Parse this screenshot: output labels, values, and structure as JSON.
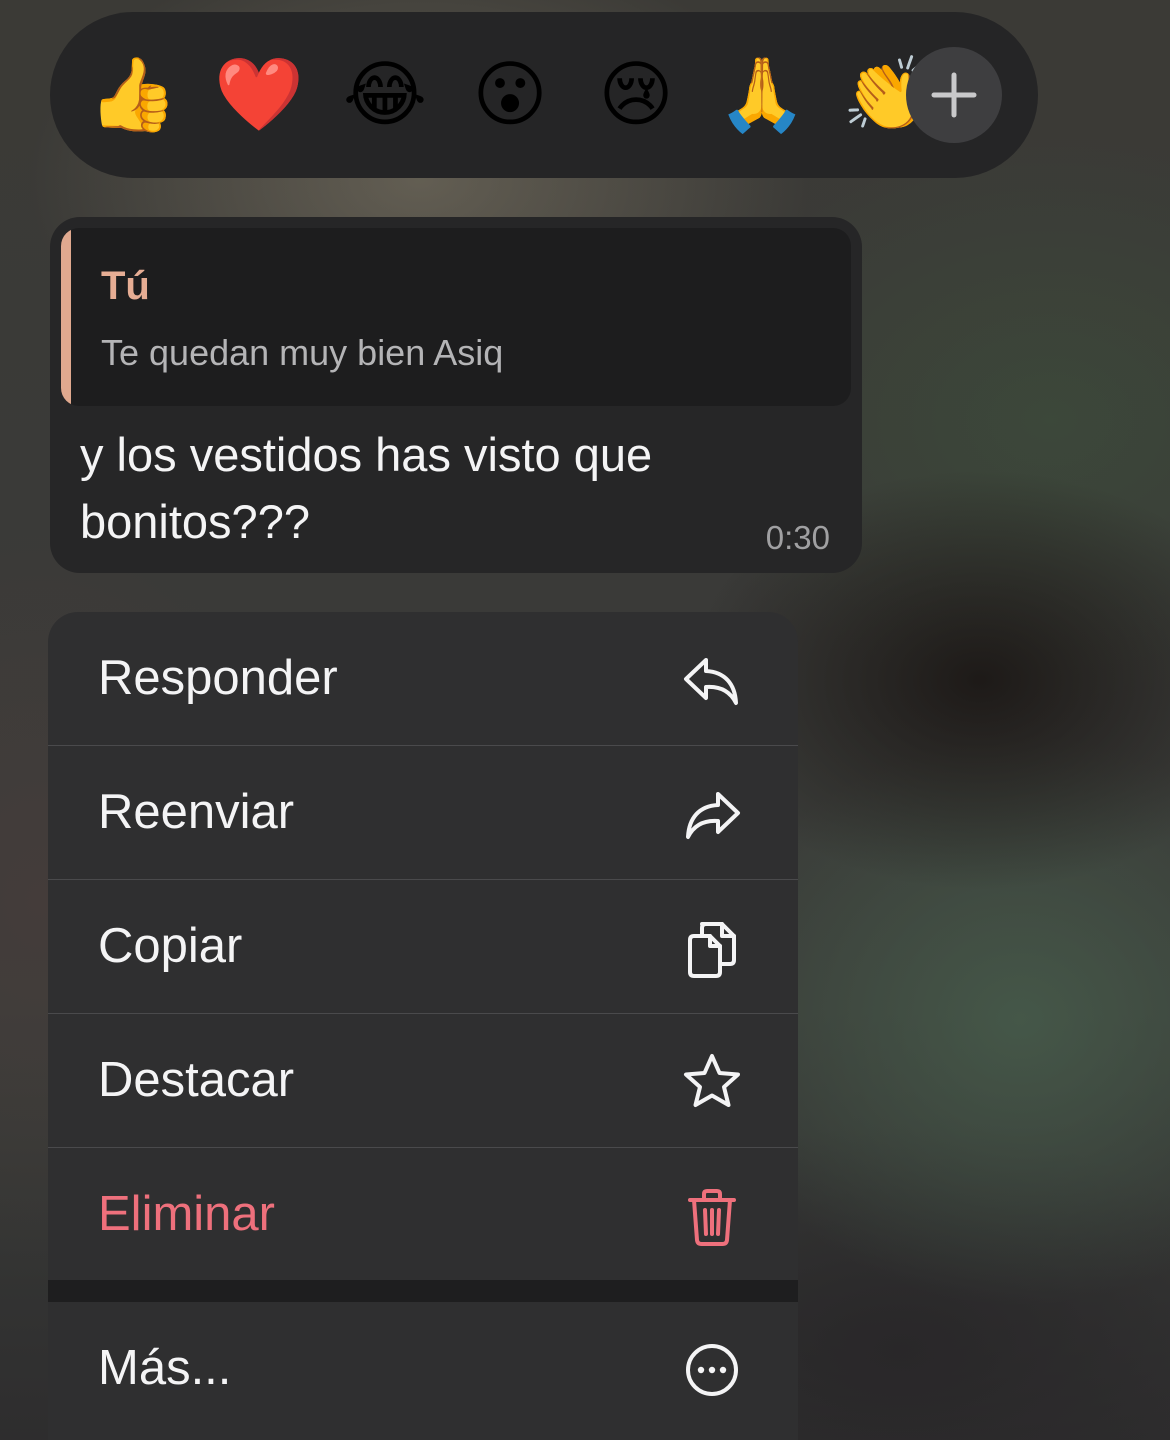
{
  "reactions": {
    "emojis": [
      {
        "icon": "thumbs-up-emoji",
        "char": "👍"
      },
      {
        "icon": "red-heart-emoji",
        "char": "❤️"
      },
      {
        "icon": "tears-of-joy-emoji",
        "char": "😂"
      },
      {
        "icon": "surprised-face-emoji",
        "char": "😮"
      },
      {
        "icon": "crying-face-emoji",
        "char": "😢"
      },
      {
        "icon": "folded-hands-emoji",
        "char": "🙏"
      },
      {
        "icon": "clapping-hands-emoji",
        "char": "👏"
      }
    ],
    "more_icon": "plus-icon"
  },
  "message": {
    "quote": {
      "author": "Tú",
      "text": "Te quedan muy bien Asiq"
    },
    "text": "y los vestidos has visto que bonitos???",
    "time": "0:30"
  },
  "menu": {
    "items": [
      {
        "label": "Responder",
        "icon": "reply-icon"
      },
      {
        "label": "Reenviar",
        "icon": "forward-icon"
      },
      {
        "label": "Copiar",
        "icon": "copy-icon"
      },
      {
        "label": "Destacar",
        "icon": "star-icon"
      },
      {
        "label": "Eliminar",
        "icon": "trash-icon"
      },
      {
        "label": "Más...",
        "icon": "more-icon"
      }
    ]
  },
  "colors": {
    "quote_accent": "#e0a98f",
    "quote_author": "#e6ad94",
    "danger": "#ee707c",
    "menu_background": "#2f2f30",
    "bubble_background": "#262627"
  }
}
